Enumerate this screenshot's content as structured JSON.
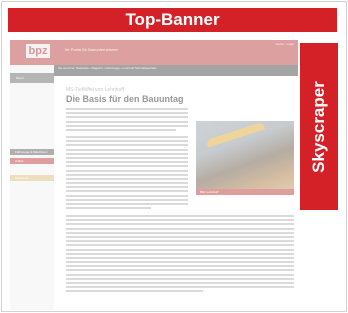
{
  "ad_slots": {
    "top_banner": "Top-Banner",
    "skyscraper": "Skyscraper"
  },
  "site": {
    "logo": "bpz",
    "header_text": "Ihr Portal für Bauunternehmer",
    "header_links": "Suche  ·  Login",
    "nav_menu": "Menü",
    "breadcrumb": "Sie sind hier:  Startseite › Magazin › Fahrzeuge › Lehnhoff Schnellwechsler",
    "kicker": "MS-Tieflöffel von Lehnhoff",
    "headline": "Die Basis für den Bauuntag",
    "side_buttons": [
      "Fahrzeuge & Maschinen",
      "Artikel",
      "Baugeräte"
    ],
    "caption": "Bild: Lehnhoff"
  },
  "colors": {
    "ad_red": "#d42127",
    "site_header": "#c05353"
  }
}
